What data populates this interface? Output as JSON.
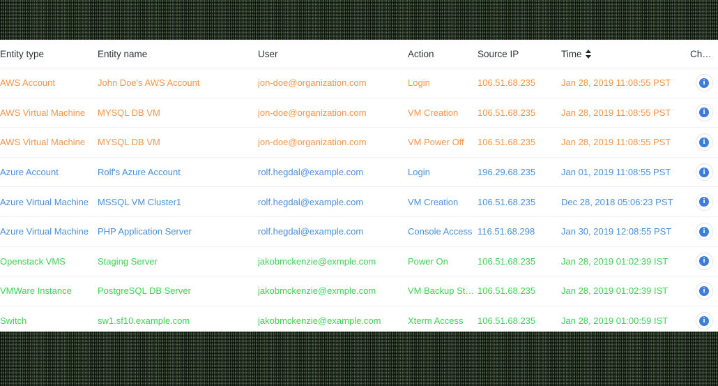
{
  "table": {
    "columns": [
      {
        "key": "entity_type",
        "label": "Entity type"
      },
      {
        "key": "entity_name",
        "label": "Entity name"
      },
      {
        "key": "user",
        "label": "User"
      },
      {
        "key": "action",
        "label": "Action"
      },
      {
        "key": "source_ip",
        "label": "Source IP"
      },
      {
        "key": "time",
        "label": "Time",
        "sortable": true,
        "sort_icon": "sort-updown-icon"
      },
      {
        "key": "changes",
        "label": "Changes"
      }
    ],
    "row_action_icon": "info-icon",
    "row_action_glyph": "i",
    "colors": {
      "orange": "#f5954a",
      "blue": "#4a90d9",
      "green": "#3ed256",
      "header_text": "#2f3438",
      "row_divider": "#edeff1",
      "info_icon_fill": "#3b7ddd"
    },
    "rows": [
      {
        "entity_type": "AWS Account",
        "entity_name": "John Doe's AWS Account",
        "user": "jon-doe@organization.com",
        "action": "Login",
        "source_ip": "106.51.68.235",
        "time": "Jan 28, 2019 11:08:55 PST",
        "color": "orange"
      },
      {
        "entity_type": "AWS Virtual Machine",
        "entity_name": "MYSQL DB VM",
        "user": "jon-doe@organization.com",
        "action": "VM Creation",
        "source_ip": "106.51.68.235",
        "time": "Jan 28, 2019 11:08:55 PST",
        "color": "orange"
      },
      {
        "entity_type": "AWS Virtual Machine",
        "entity_name": "MYSQL DB VM",
        "user": "jon-doe@organization.com",
        "action": "VM Power Off",
        "source_ip": "106.51.68.235",
        "time": "Jan 28, 2019 11:08:55 PST",
        "color": "orange"
      },
      {
        "entity_type": "Azure Account",
        "entity_name": "Rolf's Azure Account",
        "user": "rolf.hegdal@example.com",
        "action": "Login",
        "source_ip": "196.29.68.235",
        "time": "Jan 01, 2019 11:08:55 PST",
        "color": "blue"
      },
      {
        "entity_type": "Azure Virtual Machine",
        "entity_name": "MSSQL VM Cluster1",
        "user": "rolf.hegdal@example.com",
        "action": "VM Creation",
        "source_ip": "106.51.68.235",
        "time": "Dec 28, 2018 05:06:23 PST",
        "color": "blue"
      },
      {
        "entity_type": "Azure Virtual Machine",
        "entity_name": "PHP Application Server",
        "user": "rolf.hegdal@example.com",
        "action": "Console Access",
        "source_ip": "116.51.68.298",
        "time": "Jan 30, 2019 12:08:55 PST",
        "color": "blue"
      },
      {
        "entity_type": "Openstack VMS",
        "entity_name": "Staging Server",
        "user": "jakobmckenzie@exmple.com",
        "action": "Power On",
        "source_ip": "106.51.68.235",
        "time": "Jan 28, 2019 01:02:39 IST",
        "color": "green"
      },
      {
        "entity_type": "VMWare Instance",
        "entity_name": "PostgreSQL DB Server",
        "user": "jakobmckenzie@exmple.com",
        "action": "VM Backup Started",
        "source_ip": "106.51.68.235",
        "time": "Jan 28, 2019 01:02:39 IST",
        "color": "green"
      },
      {
        "entity_type": "Switch",
        "entity_name": "sw1.sf10.example.com",
        "user": "jakobmckenzie@example.com",
        "action": "Xterm Access",
        "source_ip": "106.51.68.235",
        "time": "Jan 28, 2019 01:00:59 IST",
        "color": "green"
      }
    ]
  }
}
